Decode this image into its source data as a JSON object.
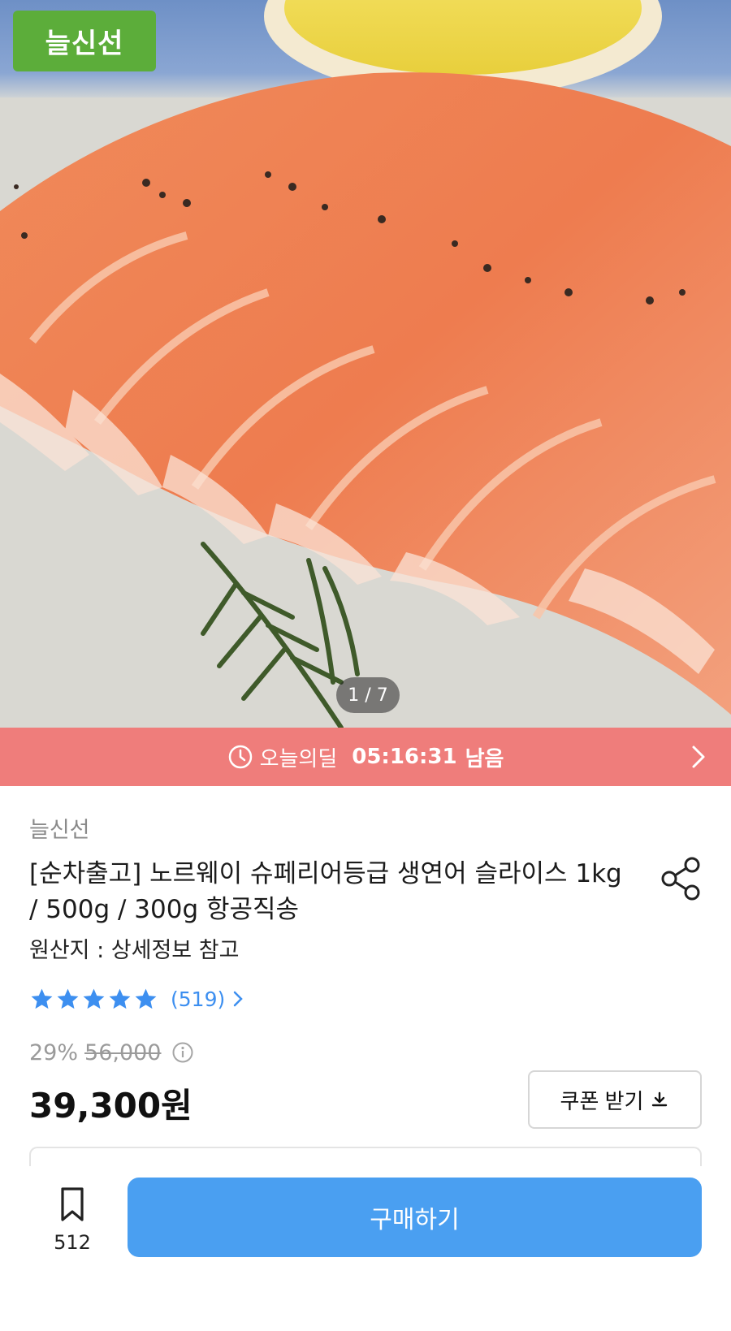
{
  "hero": {
    "brand_badge": "늘신선",
    "pager": "1 / 7"
  },
  "deal_bar": {
    "label": "오늘의딜",
    "time_left": "05:16:31",
    "remaining_suffix": "남음",
    "icon": "clock-icon",
    "color": "#ef7d7b"
  },
  "product": {
    "seller": "늘신선",
    "title": "[순차출고] 노르웨이 슈페리어등급 생연어 슬라이스 1kg / 500g / 300g 항공직송",
    "origin": "원산지 : 상세정보 참고",
    "rating": {
      "stars": 5,
      "count_text": "(519)",
      "star_color": "#3d8ff0"
    },
    "discount_percent": "29%",
    "original_price": "56,000",
    "price": "39,300원",
    "coupon_label": "쿠폰 받기"
  },
  "bottom_bar": {
    "bookmark_count": "512",
    "buy_label": "구매하기",
    "buy_color": "#4a9ff1"
  }
}
